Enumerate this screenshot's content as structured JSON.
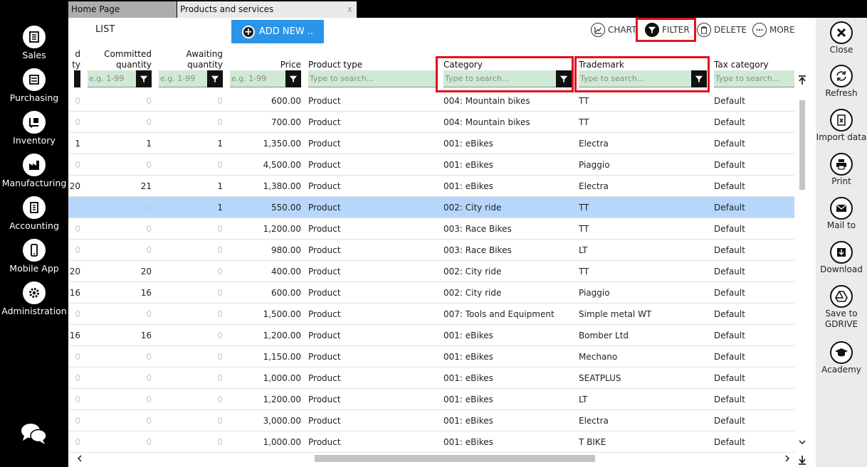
{
  "tabs": [
    {
      "label": "Home Page"
    },
    {
      "label": "Products and services",
      "close": "x"
    }
  ],
  "sidebar": {
    "items": [
      {
        "label": "Sales",
        "icon": "sales-icon"
      },
      {
        "label": "Purchasing",
        "icon": "purchasing-icon"
      },
      {
        "label": "Inventory",
        "icon": "inventory-icon"
      },
      {
        "label": "Manufacturing",
        "icon": "manufacturing-icon"
      },
      {
        "label": "Accounting",
        "icon": "accounting-icon"
      },
      {
        "label": "Mobile App",
        "icon": "mobile-icon"
      },
      {
        "label": "Administration",
        "icon": "gear-icon"
      }
    ],
    "chat_icon": "chat-icon"
  },
  "toolbar": {
    "list_label": "LIST",
    "add_new": "ADD NEW ..",
    "chart": "CHART",
    "filter": "FILTER",
    "delete": "DELETE",
    "more": "MORE"
  },
  "columns": {
    "c0": {
      "line1": "d",
      "line2": "ty"
    },
    "committed": {
      "line1": "Committed",
      "line2": "quantity"
    },
    "awaiting": {
      "line1": "Awaiting",
      "line2": "quantity"
    },
    "price": "Price",
    "product_type": "Product type",
    "category": "Category",
    "trademark": "Trademark",
    "tax_category": "Tax category"
  },
  "filters": {
    "range_placeholder": "e.g. 1-99",
    "text_placeholder": "Type to search..."
  },
  "highlight_color": "#e0121f",
  "selected_row": 5,
  "rows": [
    {
      "c0": "0",
      "committed": "0",
      "awaiting": "0",
      "price": "600.00",
      "type": "Product",
      "category": "004: Mountain bikes",
      "trademark": "TT",
      "tax": "Default"
    },
    {
      "c0": "0",
      "committed": "0",
      "awaiting": "0",
      "price": "700.00",
      "type": "Product",
      "category": "004: Mountain bikes",
      "trademark": "TT",
      "tax": "Default"
    },
    {
      "c0": "1",
      "committed": "1",
      "awaiting": "1",
      "price": "1,350.00",
      "type": "Product",
      "category": "001: eBikes",
      "trademark": "Electra",
      "tax": "Default"
    },
    {
      "c0": "0",
      "committed": "0",
      "awaiting": "0",
      "price": "4,500.00",
      "type": "Product",
      "category": "001: eBikes",
      "trademark": "Piaggio",
      "tax": "Default"
    },
    {
      "c0": "20",
      "committed": "21",
      "awaiting": "1",
      "price": "1,380.00",
      "type": "Product",
      "category": "001: eBikes",
      "trademark": "Electra",
      "tax": "Default"
    },
    {
      "c0": "",
      "committed": "0",
      "awaiting": "1",
      "price": "550.00",
      "type": "Product",
      "category": "002: City ride",
      "trademark": "TT",
      "tax": "Default"
    },
    {
      "c0": "0",
      "committed": "0",
      "awaiting": "0",
      "price": "1,200.00",
      "type": "Product",
      "category": "003: Race Bikes",
      "trademark": "TT",
      "tax": "Default"
    },
    {
      "c0": "0",
      "committed": "0",
      "awaiting": "0",
      "price": "980.00",
      "type": "Product",
      "category": "003: Race Bikes",
      "trademark": "LT",
      "tax": "Default"
    },
    {
      "c0": "20",
      "committed": "20",
      "awaiting": "0",
      "price": "400.00",
      "type": "Product",
      "category": "002: City ride",
      "trademark": "TT",
      "tax": "Default"
    },
    {
      "c0": "16",
      "committed": "16",
      "awaiting": "0",
      "price": "600.00",
      "type": "Product",
      "category": "002: City ride",
      "trademark": "Piaggio",
      "tax": "Default"
    },
    {
      "c0": "0",
      "committed": "0",
      "awaiting": "0",
      "price": "1,500.00",
      "type": "Product",
      "category": "007: Tools and Equipment",
      "trademark": "Simple metal WT",
      "tax": "Default"
    },
    {
      "c0": "16",
      "committed": "16",
      "awaiting": "0",
      "price": "1,200.00",
      "type": "Product",
      "category": "001: eBikes",
      "trademark": "Bomber Ltd",
      "tax": "Default"
    },
    {
      "c0": "0",
      "committed": "0",
      "awaiting": "0",
      "price": "1,150.00",
      "type": "Product",
      "category": "001: eBikes",
      "trademark": "Mechano",
      "tax": "Default"
    },
    {
      "c0": "0",
      "committed": "0",
      "awaiting": "0",
      "price": "1,000.00",
      "type": "Product",
      "category": "001: eBikes",
      "trademark": "SEATPLUS",
      "tax": "Default"
    },
    {
      "c0": "0",
      "committed": "0",
      "awaiting": "0",
      "price": "1,200.00",
      "type": "Product",
      "category": "001: eBikes",
      "trademark": "LT",
      "tax": "Default"
    },
    {
      "c0": "0",
      "committed": "0",
      "awaiting": "0",
      "price": "3,000.00",
      "type": "Product",
      "category": "001: eBikes",
      "trademark": "Electra",
      "tax": "Default"
    },
    {
      "c0": "0",
      "committed": "0",
      "awaiting": "0",
      "price": "1,000.00",
      "type": "Product",
      "category": "001: eBikes",
      "trademark": "T BIKE",
      "tax": "Default"
    }
  ],
  "right_panel": [
    {
      "label": "Close",
      "icon": "close-icon"
    },
    {
      "label": "Refresh",
      "icon": "refresh-icon"
    },
    {
      "label": "Import data",
      "icon": "import-excel-icon"
    },
    {
      "label": "Print",
      "icon": "printer-icon"
    },
    {
      "label": "Mail to",
      "icon": "mail-icon"
    },
    {
      "label": "Download",
      "icon": "download-icon"
    },
    {
      "label": "Save to GDRIVE",
      "icon": "gdrive-icon"
    },
    {
      "label": "Academy",
      "icon": "graduation-cap-icon"
    }
  ]
}
